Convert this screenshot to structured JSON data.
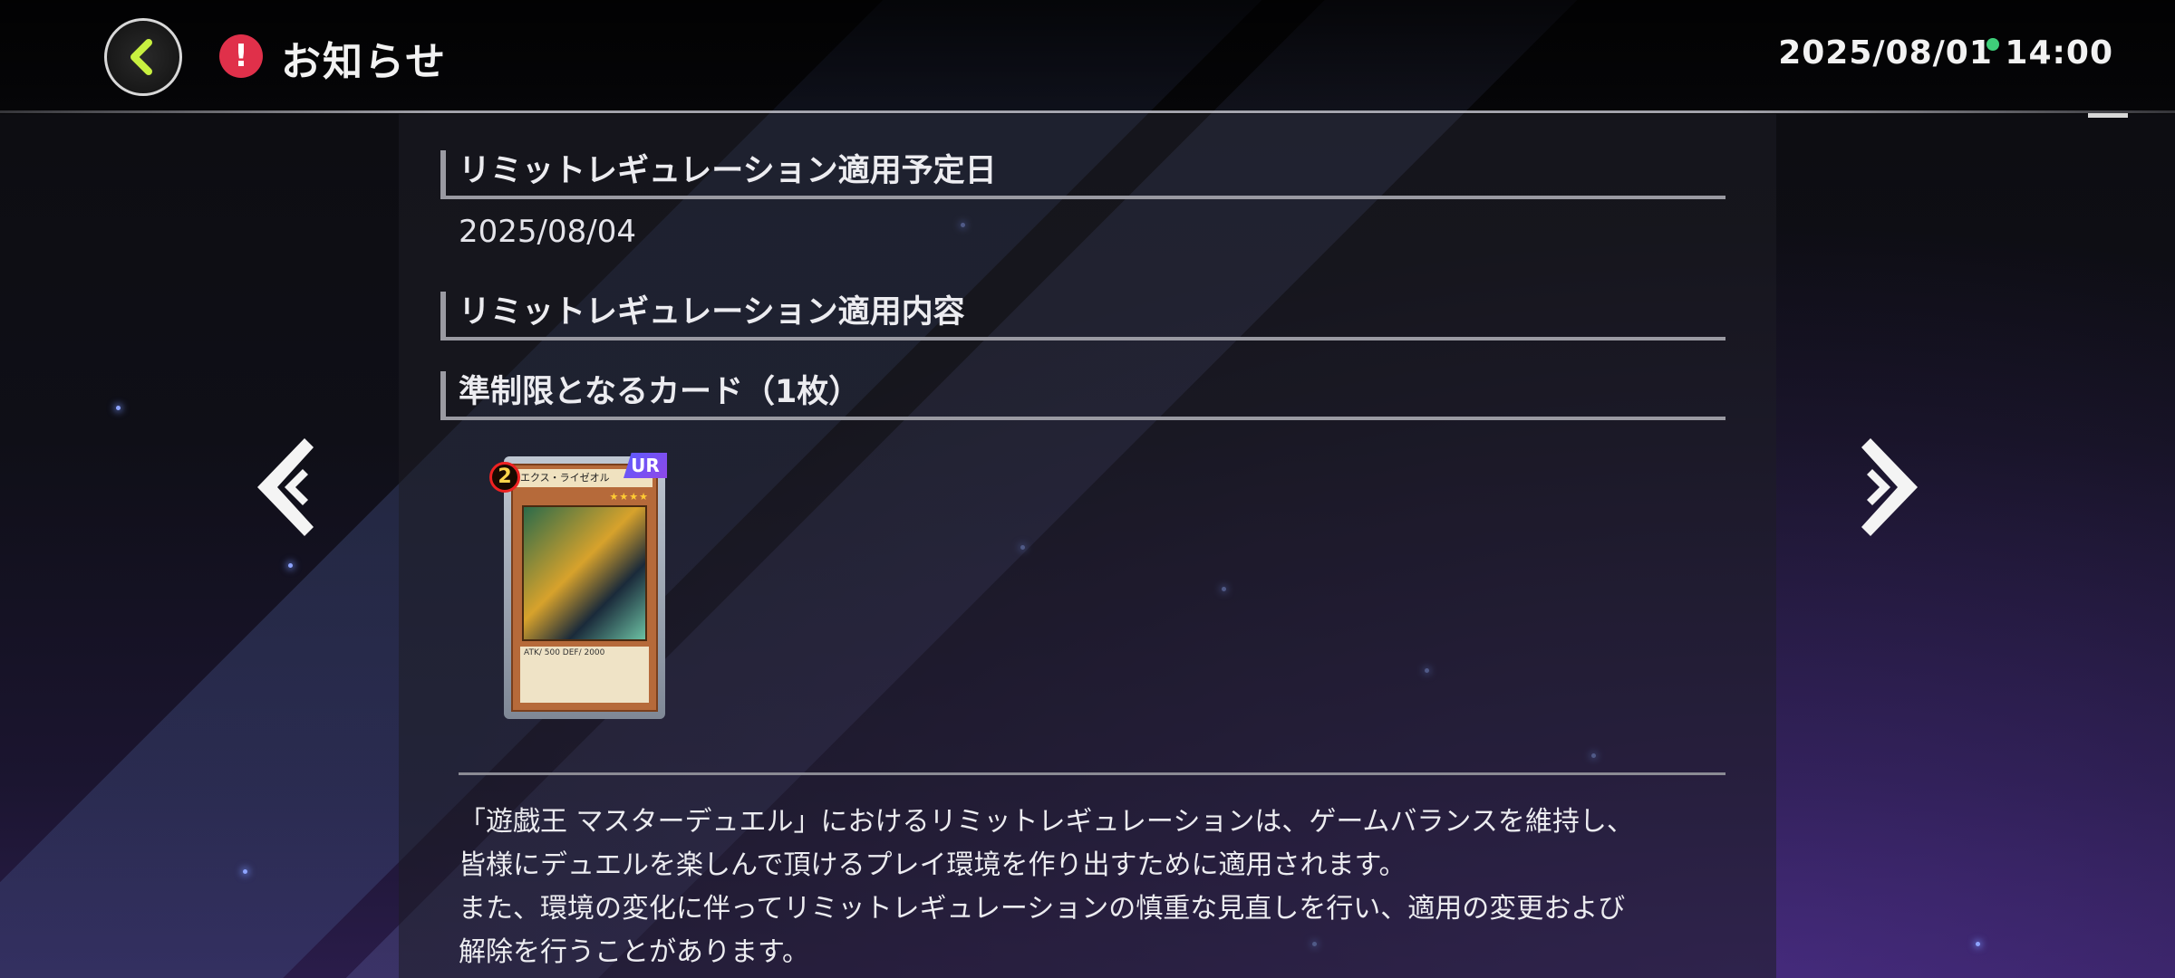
{
  "header": {
    "title": "お知らせ",
    "clock": "2025/08/01 14:00",
    "back_label": "back"
  },
  "notice": {
    "heading_date": "リミットレギュレーション適用予定日",
    "apply_date": "2025/08/04",
    "heading_content": "リミットレギュレーション適用内容",
    "heading_semi_limited": "準制限となるカード（1枚）",
    "card": {
      "rarity": "UR",
      "count": "2",
      "name": "エクス・ライゼオル",
      "stars": "★★★★",
      "stats": "ATK/ 500 DEF/ 2000"
    },
    "body_lines": [
      "「遊戯王 マスターデュエル」におけるリミットレギュレーションは、ゲームバランスを維持し、",
      "皆様にデュエルを楽しんで頂けるプレイ環境を作り出すために適用されます。",
      "また、環境の変化に伴ってリミットレギュレーションの慎重な見直しを行い、適用の変更および",
      "解除を行うことがあります。"
    ]
  },
  "colors": {
    "accent_green": "#c8f040",
    "alert_red": "#e0304a",
    "rarity_purple": "#7a4cf0"
  },
  "icons": {
    "back": "chevron-left-icon",
    "alert": "exclamation-icon",
    "prev": "double-chevron-left-icon",
    "next": "double-chevron-right-icon"
  }
}
